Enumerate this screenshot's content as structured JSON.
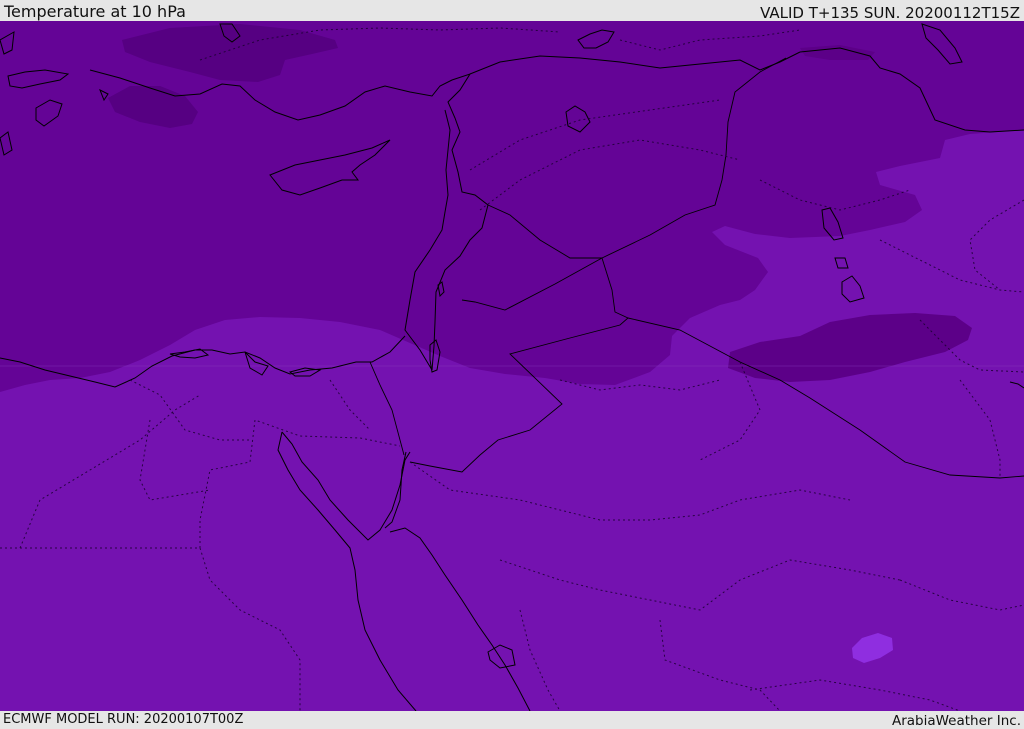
{
  "header": {
    "title": "Temperature at 10 hPa",
    "valid_time": "VALID T+135 SUN. 20200112T15Z"
  },
  "footer": {
    "model_run": "ECMWF MODEL RUN: 20200107T00Z",
    "credit": "ArabiaWeather Inc."
  },
  "map": {
    "field": "temperature",
    "level": "10 hPa",
    "colors": {
      "coldest_band": "#560082",
      "cold_band": "#640496",
      "mid_band": "#7412b0",
      "warm_spot": "#8f2ee0",
      "boundary_line": "#000000",
      "border_line": "#1a0030"
    }
  }
}
